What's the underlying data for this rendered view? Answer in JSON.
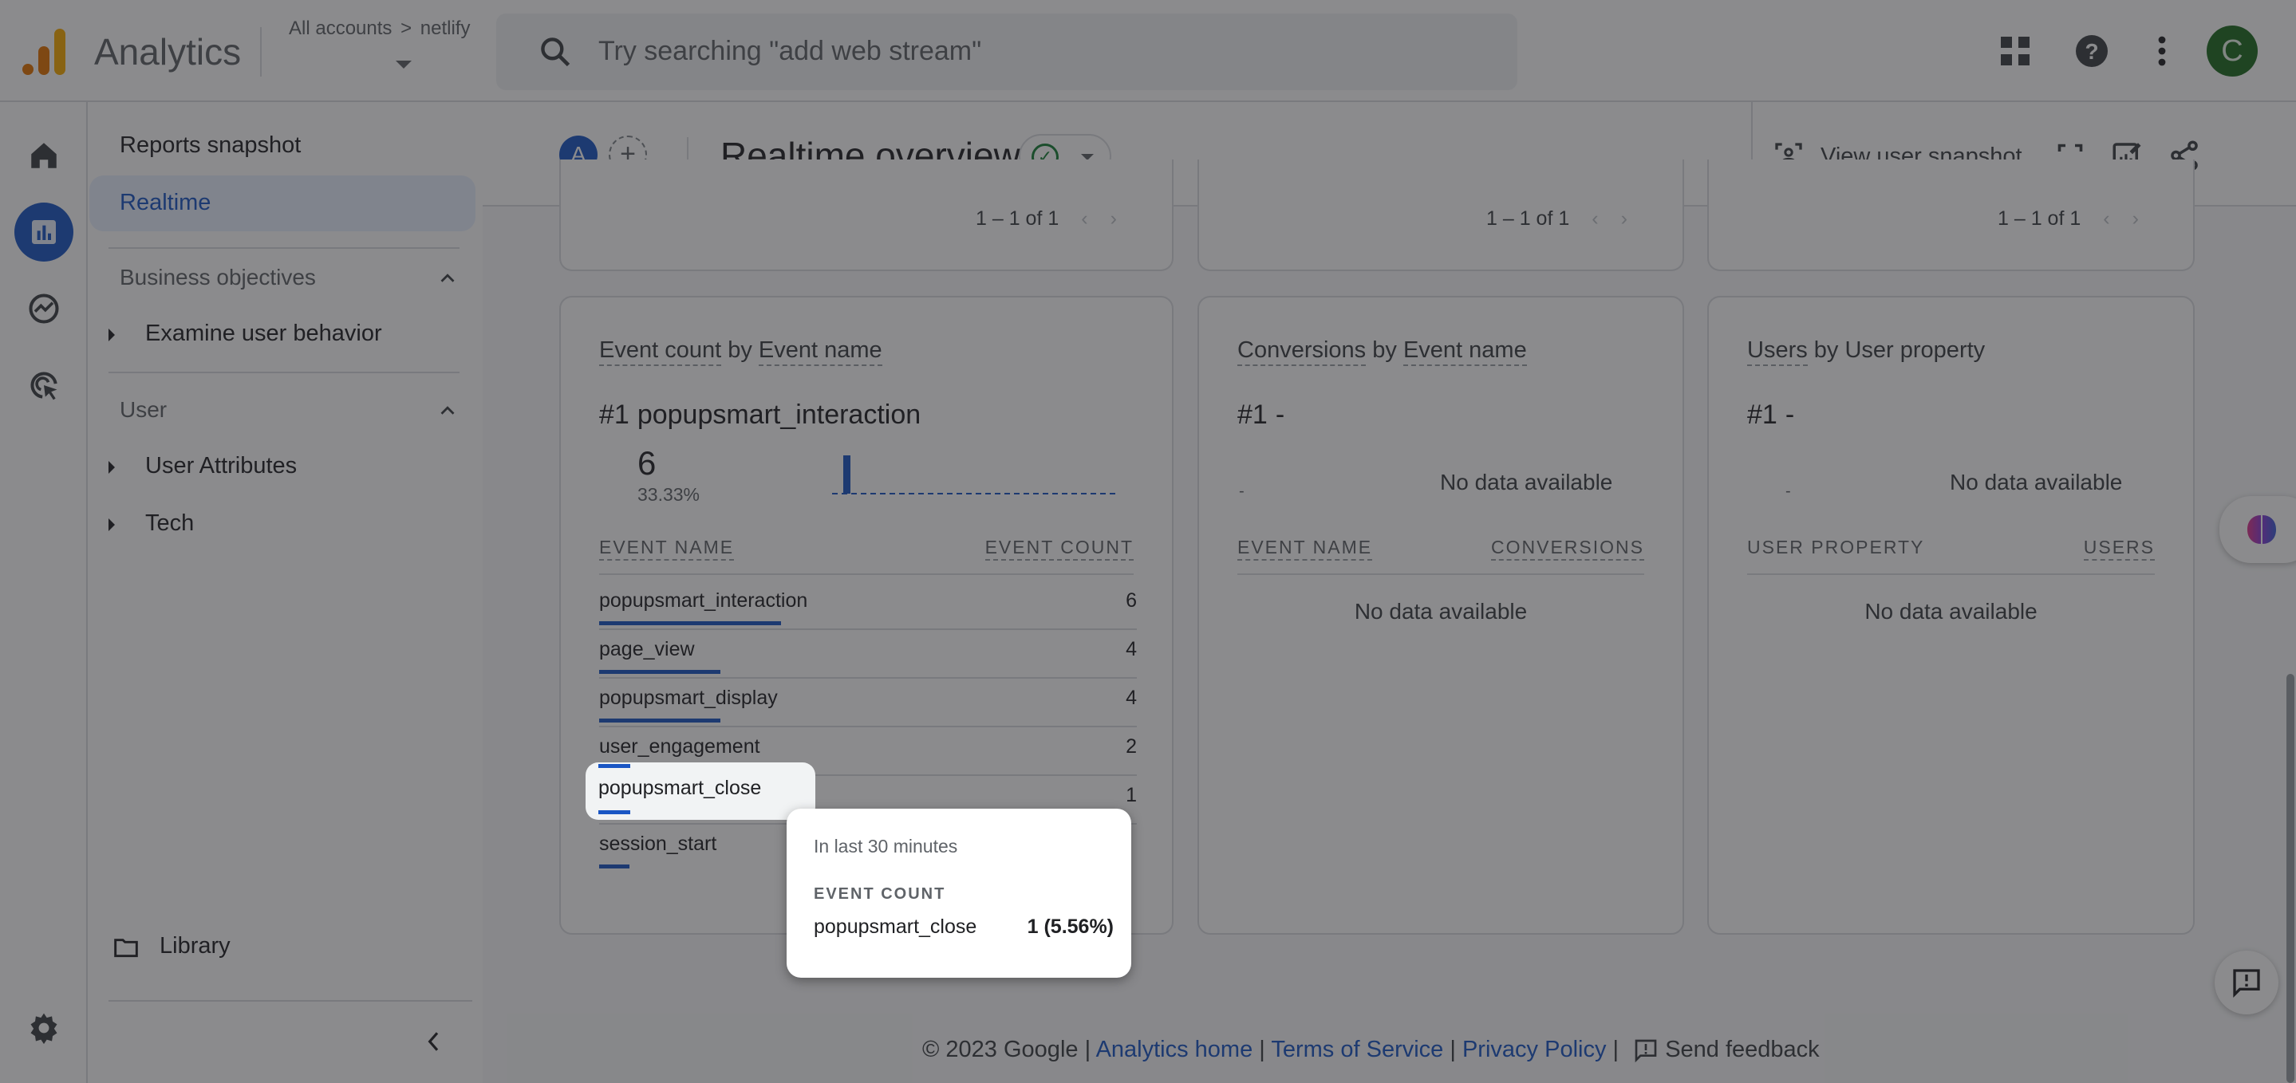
{
  "app": {
    "title": "Analytics",
    "breadcrumb": {
      "root": "All accounts",
      "separator": ">",
      "account": "netlify"
    },
    "search_placeholder": "Try searching \"add web stream\"",
    "avatar_initial": "C",
    "colors": {
      "brand_orange": "#e37400",
      "brand_yellow": "#f9ab00",
      "accent_blue": "#1a56c4",
      "avatar_green": "#1e6b21",
      "ok_green": "#188038"
    }
  },
  "sidebar": {
    "top_item": "Reports snapshot",
    "active_item": "Realtime",
    "sections": [
      {
        "label": "Business objectives",
        "items": [
          {
            "label": "Examine user behavior"
          }
        ]
      },
      {
        "label": "User",
        "items": [
          {
            "label": "User Attributes"
          },
          {
            "label": "Tech"
          }
        ]
      }
    ],
    "library": "Library"
  },
  "subheader": {
    "segment_badge": "A",
    "add_segment": "+",
    "page_title": "Realtime overview",
    "view_user_snapshot": "View user snapshot"
  },
  "top_pagers": [
    "1 – 1 of 1",
    "1 – 1 of 1",
    "1 – 1 of 1"
  ],
  "cards": [
    {
      "title_metric": "Event count",
      "title_by": "by",
      "title_dim": "Event name",
      "rank": "#1",
      "rank_name": "popupsmart_interaction",
      "top_value": "6",
      "top_pct": "33.33%",
      "col_left": "EVENT NAME",
      "col_right": "EVENT COUNT",
      "rows": [
        {
          "name": "popupsmart_interaction",
          "value": "6",
          "share": 1.0
        },
        {
          "name": "page_view",
          "value": "4",
          "share": 0.667
        },
        {
          "name": "popupsmart_display",
          "value": "4",
          "share": 0.667
        },
        {
          "name": "user_engagement",
          "value": "2",
          "share": 0.333
        },
        {
          "name": "popupsmart_close",
          "value": "1",
          "share": 0.167
        },
        {
          "name": "session_start",
          "value": "",
          "share": 0.167
        }
      ]
    },
    {
      "title_metric": "Conversions",
      "title_by": "by",
      "title_dim": "Event name",
      "rank": "#1",
      "rank_name": "-",
      "dash": "-",
      "chart_empty": "No data available",
      "col_left": "EVENT NAME",
      "col_right": "CONVERSIONS",
      "table_empty": "No data available"
    },
    {
      "title_metric": "Users",
      "title_by": "by User property",
      "rank": "#1",
      "rank_name": "-",
      "dash": "-",
      "chart_empty": "No data available",
      "col_left": "USER PROPERTY",
      "col_right": "USERS",
      "table_empty": "No data available"
    }
  ],
  "tooltip": {
    "period": "In last 30 minutes",
    "metric": "EVENT COUNT",
    "name": "popupsmart_close",
    "value": "1 (5.56%)"
  },
  "footer": {
    "copyright": "© 2023 Google",
    "links": [
      "Analytics home",
      "Terms of Service",
      "Privacy Policy"
    ],
    "feedback": "Send feedback"
  }
}
